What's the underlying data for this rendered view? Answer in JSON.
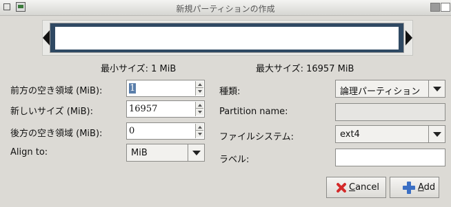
{
  "window": {
    "title": "新規パーティションの作成"
  },
  "size_info": {
    "min_label": "最小サイズ: 1 MiB",
    "max_label": "最大サイズ: 16957 MiB"
  },
  "left_form": {
    "free_before": {
      "label": "前方の空き領域 (MiB):",
      "value": "1"
    },
    "new_size": {
      "label": "新しいサイズ (MiB):",
      "value": "16957"
    },
    "free_after": {
      "label": "後方の空き領域 (MiB):",
      "value": "0"
    },
    "align_to": {
      "label": "Align to:",
      "value": "MiB"
    }
  },
  "right_form": {
    "type": {
      "label": "種類:",
      "value": "論理パーティション"
    },
    "partition_name": {
      "label": "Partition name:",
      "value": ""
    },
    "filesystem": {
      "label": "ファイルシステム:",
      "value": "ext4"
    },
    "label": {
      "label": "ラベル:",
      "value": ""
    }
  },
  "buttons": {
    "cancel": {
      "mnemonic": "C",
      "rest": "ancel"
    },
    "add": {
      "mnemonic": "A",
      "rest": "dd"
    }
  },
  "colors": {
    "partition_fill": "#2f4963",
    "selection": "#5a7eaa",
    "cancel_icon": "#d42a2a",
    "add_icon": "#3b6fc4"
  },
  "icons": [
    "window-menu-icon",
    "app-icon",
    "maximize-icon",
    "close-icon",
    "cancel-icon",
    "add-icon"
  ]
}
